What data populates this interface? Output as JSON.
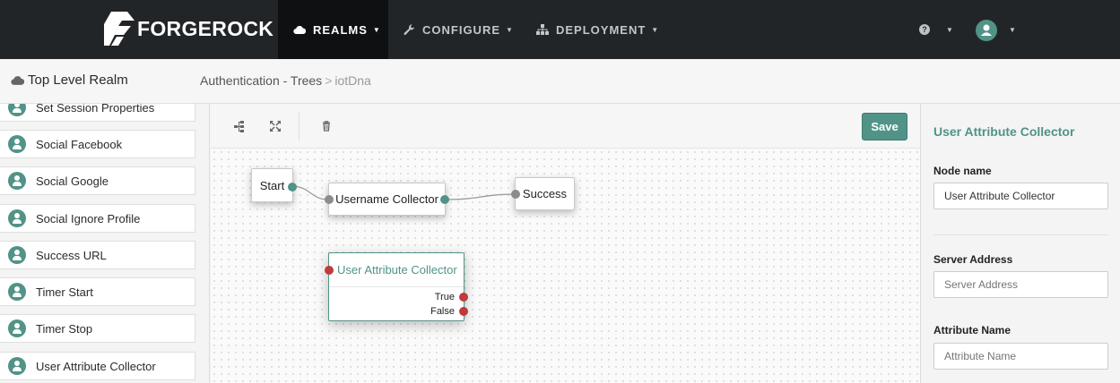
{
  "brand": {
    "name": "FORGEROCK"
  },
  "nav": {
    "realms": "REALMS",
    "configure": "CONFIGURE",
    "deployment": "DEPLOYMENT",
    "help": "?"
  },
  "breadcrumb": {
    "realm": "Top Level Realm",
    "section": "Authentication - Trees",
    "separator": ">",
    "current": "iotDna"
  },
  "sidebar": {
    "items": [
      "Set Session Properties",
      "Social Facebook",
      "Social Google",
      "Social Ignore Profile",
      "Success URL",
      "Timer Start",
      "Timer Stop",
      "User Attribute Collector"
    ]
  },
  "toolbar": {
    "save_label": "Save"
  },
  "canvas": {
    "start": "Start",
    "username_collector": "Username Collector",
    "success": "Success",
    "uac": {
      "title": "User Attribute Collector",
      "outcome_true": "True",
      "outcome_false": "False"
    }
  },
  "properties": {
    "title": "User Attribute Collector",
    "node_name_label": "Node name",
    "node_name_value": "User Attribute Collector",
    "server_address_label": "Server Address",
    "server_address_placeholder": "Server Address",
    "attribute_name_label": "Attribute Name",
    "attribute_name_placeholder": "Attribute Name"
  },
  "colors": {
    "accent": "#519387",
    "topbar": "#222527",
    "error_port": "#c0393b"
  }
}
